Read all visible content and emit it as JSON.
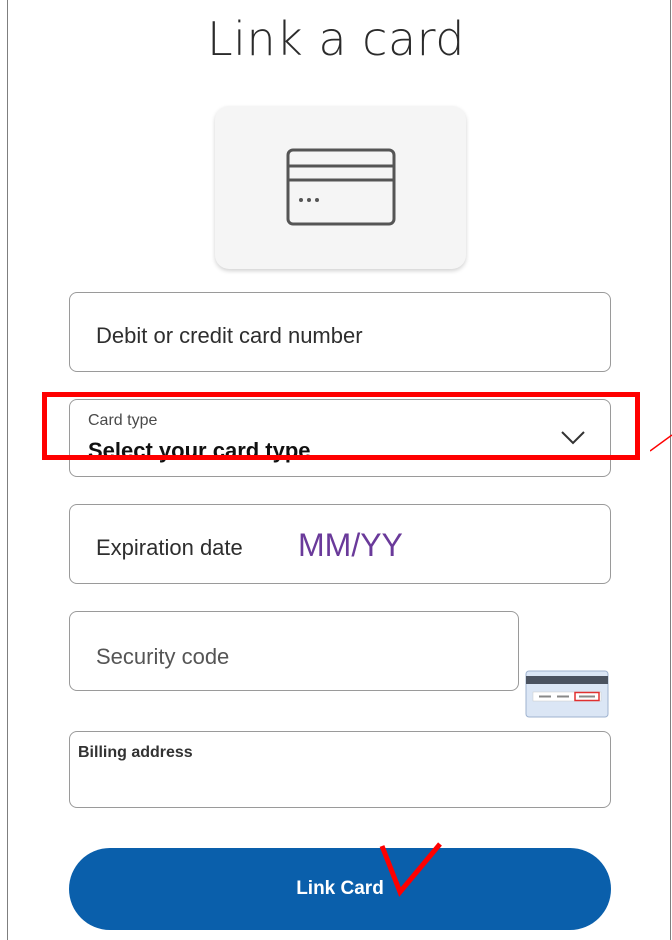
{
  "page": {
    "title": "Link a card"
  },
  "card_tile": {
    "icon": "credit-card-icon"
  },
  "fields": {
    "card_number": {
      "placeholder": "Debit or credit card number"
    },
    "card_type": {
      "label": "Card type",
      "value": "Select your card type",
      "icon": "chevron-down-icon"
    },
    "expiration": {
      "placeholder": "Expiration date",
      "format_hint": "MM/YY"
    },
    "security_code": {
      "placeholder": "Security code",
      "hint_icon": "card-back-cvv-icon"
    },
    "billing_address": {
      "label": "Billing address"
    }
  },
  "actions": {
    "link_card": "Link Card"
  },
  "annotations": {
    "highlight_color": "#ff0000",
    "hint_color": "#6a3a9a"
  },
  "colors": {
    "primary_button": "#0a5fab",
    "field_border": "#9a9a9a"
  }
}
